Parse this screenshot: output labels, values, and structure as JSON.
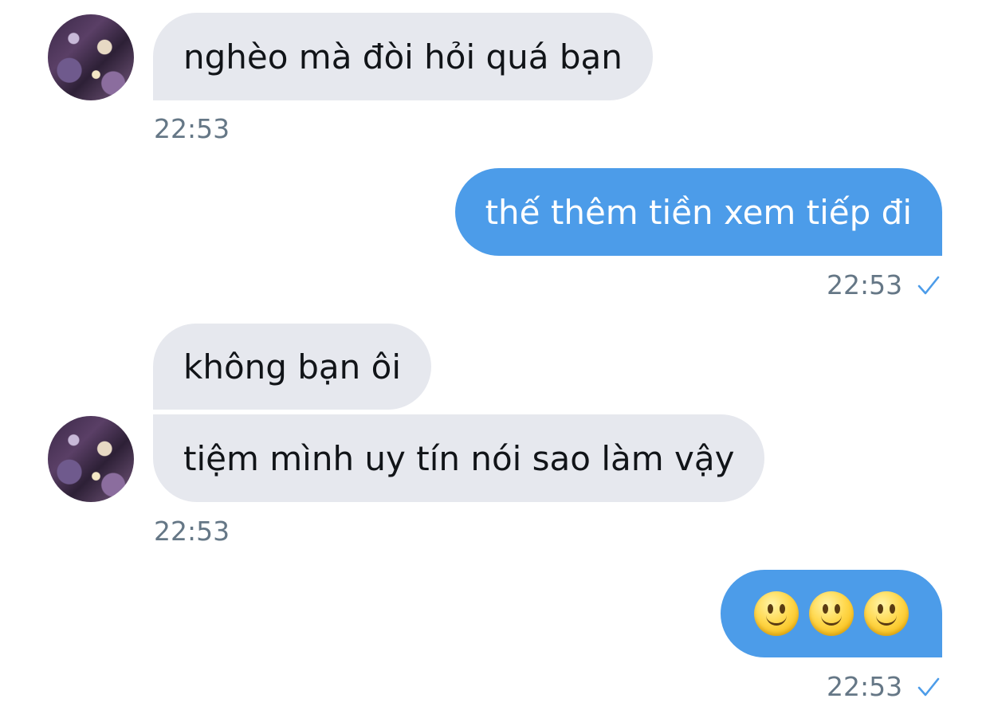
{
  "messages": [
    {
      "id": "m1",
      "direction": "incoming",
      "text": "nghèo mà đòi hỏi quá bạn",
      "time": "22:53"
    },
    {
      "id": "m2",
      "direction": "outgoing",
      "text": "thế thêm tiền xem tiếp đi",
      "time": "22:53",
      "status": "sent"
    },
    {
      "id": "m3",
      "direction": "incoming",
      "text": "không bạn ôi"
    },
    {
      "id": "m4",
      "direction": "incoming",
      "text": "tiệm mình uy tín nói sao làm vậy",
      "time": "22:53"
    },
    {
      "id": "m5",
      "direction": "outgoing",
      "text": "🙂🙂🙂",
      "emoji": [
        "slightly-smiling-face",
        "slightly-smiling-face",
        "slightly-smiling-face"
      ],
      "time": "22:53",
      "status": "sent"
    }
  ],
  "icons": {
    "avatar": "contact-avatar",
    "status": "checkmark-icon"
  },
  "colors": {
    "incoming_bubble": "#e6e8ee",
    "outgoing_bubble": "#4c9ce9",
    "timestamp": "#657786",
    "check": "#4c9ce9"
  }
}
